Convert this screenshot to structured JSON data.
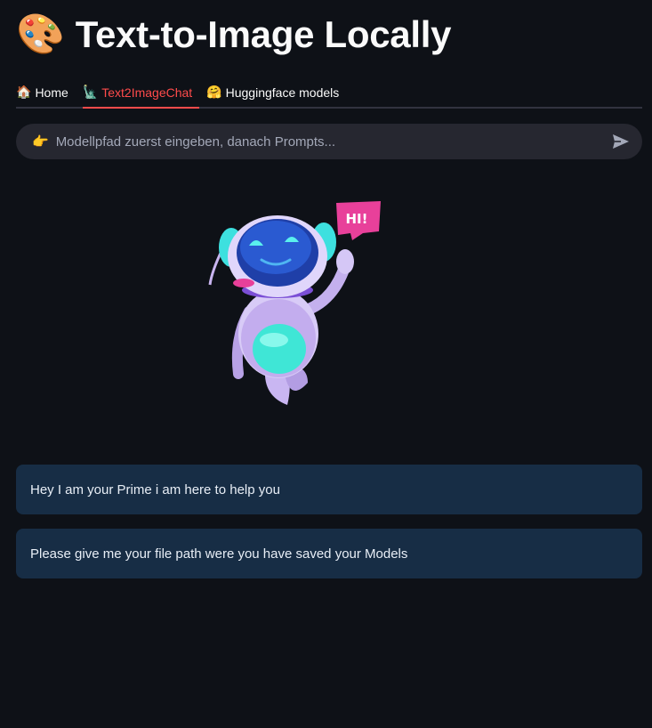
{
  "header": {
    "emoji": "🎨",
    "title": "Text-to-Image Locally"
  },
  "tabs": [
    {
      "icon": "🏠",
      "label": "Home",
      "active": false
    },
    {
      "icon": "🗽",
      "label": "Text2ImageChat",
      "active": true
    },
    {
      "icon": "🤗",
      "label": "Huggingface models",
      "active": false
    }
  ],
  "chat_input": {
    "icon": "👉",
    "placeholder": "Modellpfad zuerst eingeben, danach Prompts...",
    "value": ""
  },
  "robot": {
    "badge_text": "HI!"
  },
  "messages": [
    {
      "text": "Hey I am your Prime i am here to help you"
    },
    {
      "text": "Please give me your file path were you have saved your Models"
    }
  ],
  "colors": {
    "background": "#0e1117",
    "accent": "#ff4b4b",
    "message_bg": "#172d45",
    "input_bg": "#262730"
  }
}
